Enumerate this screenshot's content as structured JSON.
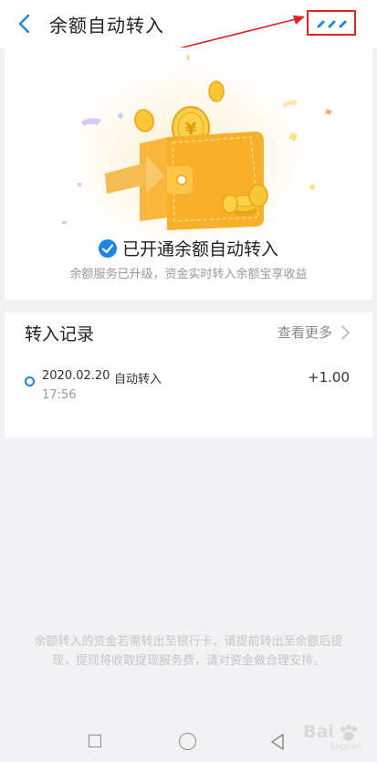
{
  "header": {
    "title": "余额自动转入",
    "back_icon": "chevron-left-icon",
    "more_icon": "more-dots-icon"
  },
  "hero": {
    "status_text": "已开通余额自动转入",
    "subtitle": "余额服务已升级，资金实时转入余额宝享收益",
    "coin_symbol": "¥"
  },
  "records": {
    "title": "转入记录",
    "see_more": "查看更多",
    "items": [
      {
        "date": "2020.02.20",
        "type": "自动转入",
        "time": "17:56",
        "amount": "+1.00"
      }
    ]
  },
  "notice": "余额转入的资金若需转出至银行卡，请提前转出至余额后提现，提现将收取提现服务费，请对资金做合理安排。",
  "watermark": {
    "text": "Bai",
    "sub": "jingyan"
  },
  "colors": {
    "accent": "#1b86e5",
    "annotation": "#e32222",
    "wallet": "#f5a623",
    "background": "#f2f2f4"
  }
}
